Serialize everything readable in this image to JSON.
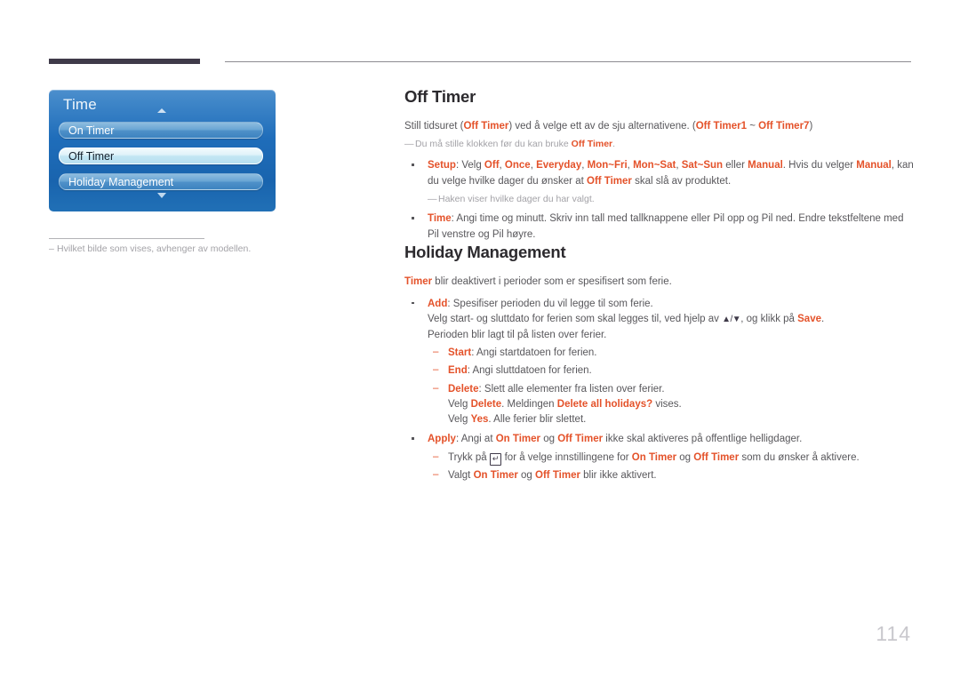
{
  "page": {
    "number": "114",
    "accent_color": "#e4522a",
    "body_color": "#58575b",
    "heading_color": "#2c2a2e",
    "note_color": "#a3a2a7",
    "rule_color": "#3f3a49"
  },
  "osd": {
    "title": "Time",
    "scroll_up_icon": "caret-up-icon",
    "scroll_down_icon": "caret-down-icon",
    "items": [
      {
        "label": "On Timer",
        "selected": false
      },
      {
        "label": "Off Timer",
        "selected": true
      },
      {
        "label": "Holiday Management",
        "selected": false
      }
    ]
  },
  "figure_note": {
    "marker": "–",
    "text": "Hvilket bilde som vises, avhenger av modellen."
  },
  "sections": [
    {
      "heading": "Off Timer",
      "lead": {
        "p1": "Still tidsuret (",
        "t1": "Off Timer",
        "p2": ") ved å velge ett av de sju alternativene. (",
        "t2": "Off Timer1",
        "p3": " ~ ",
        "t3": "Off Timer7",
        "p4": ")"
      },
      "note": {
        "marker": "—",
        "p1": "Du må stille klokken før du kan bruke ",
        "t1": "Off Timer",
        "p2": "."
      },
      "bullets": [
        {
          "term": "Setup",
          "p1": ": Velg ",
          "t1": "Off",
          "p2": ", ",
          "t2": "Once",
          "p3": ", ",
          "t3": "Everyday",
          "p4": ", ",
          "t4": "Mon~Fri",
          "p5": ", ",
          "t5": "Mon~Sat",
          "p6": ", ",
          "t6": "Sat~Sun",
          "p7": " eller ",
          "t7": "Manual",
          "p8": ". Hvis du velger ",
          "t8": "Manual",
          "p9": ", kan du velge hvilke dager du ønsker at ",
          "t9": "Off Timer",
          "p10": " skal slå av produktet.",
          "note": {
            "marker": "—",
            "text": "Haken viser hvilke dager du har valgt."
          }
        },
        {
          "term": "Time",
          "text": ": Angi time og minutt. Skriv inn tall med tallknappene eller Pil opp og Pil ned. Endre tekstfeltene med Pil venstre og Pil høyre."
        }
      ]
    },
    {
      "heading": "Holiday Management",
      "lead": {
        "t1": "Timer",
        "p1": " blir deaktivert i perioder som er spesifisert som ferie."
      },
      "bullets": [
        {
          "term": "Add",
          "text": ": Spesifiser perioden du vil legge til som ferie.",
          "line2_a": "Velg start- og sluttdato for ferien som skal legges til, ved hjelp av ",
          "line2_icons": "▲/▼",
          "line2_b": ", og klikk på ",
          "line2_term": "Save",
          "line2_c": ".",
          "line3": "Perioden blir lagt til på listen over ferier.",
          "subs": [
            {
              "term": "Start",
              "text": ": Angi startdatoen for ferien."
            },
            {
              "term": "End",
              "text": ": Angi sluttdatoen for ferien."
            },
            {
              "term": "Delete",
              "text": ": Slett alle elementer fra listen over ferier.",
              "line2_a": "Velg ",
              "line2_t1": "Delete",
              "line2_b": ". Meldingen ",
              "line2_t2": "Delete all holidays?",
              "line2_c": " vises.",
              "line3_a": "Velg ",
              "line3_t1": "Yes",
              "line3_b": ". Alle ferier blir slettet."
            }
          ]
        },
        {
          "term": "Apply",
          "p1": ": Angi at ",
          "t1": "On Timer",
          "p2": " og ",
          "t2": "Off Timer",
          "p3": " ikke skal aktiveres på offentlige helligdager.",
          "subs": [
            {
              "a": "Trykk på ",
              "icon": "enter-key-icon",
              "icon_glyph": "↵",
              "b": " for å velge innstillingene for ",
              "t1": "On Timer",
              "c": " og ",
              "t2": "Off Timer",
              "d": " som du ønsker å aktivere."
            },
            {
              "a": "Valgt ",
              "t1": "On Timer",
              "b": " og ",
              "t2": "Off Timer",
              "c": " blir ikke aktivert."
            }
          ]
        }
      ]
    }
  ]
}
